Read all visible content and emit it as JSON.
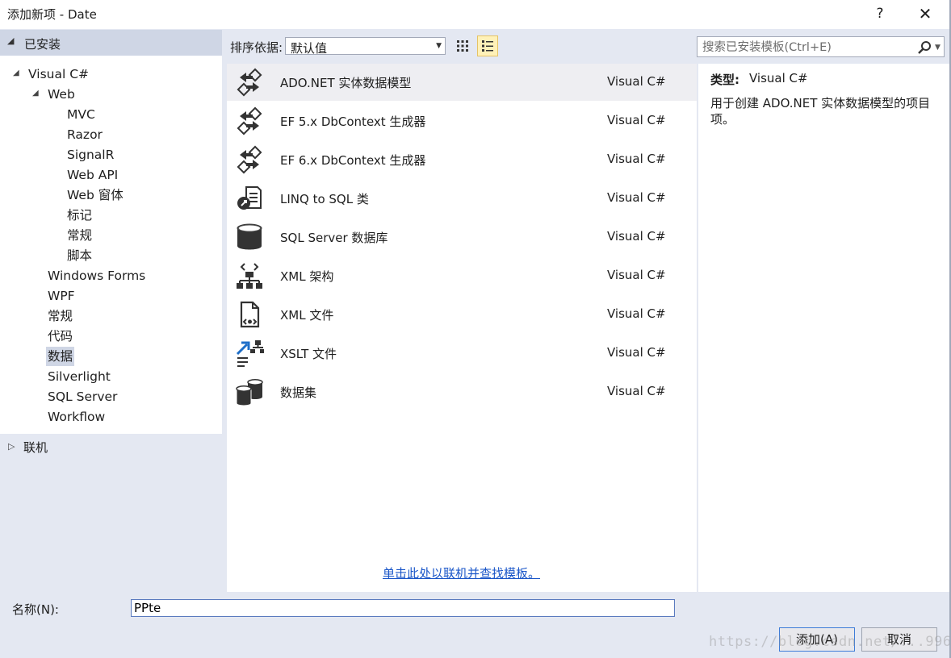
{
  "window": {
    "title": "添加新项 - Date",
    "help_glyph": "?",
    "close_glyph": "✕"
  },
  "sidebar": {
    "installed_label": "已安装",
    "tree": [
      {
        "label": "Visual C#",
        "expanded": true
      },
      {
        "label": "Web",
        "expanded": true
      },
      {
        "label": "MVC"
      },
      {
        "label": "Razor"
      },
      {
        "label": "SignalR"
      },
      {
        "label": "Web API"
      },
      {
        "label": "Web 窗体"
      },
      {
        "label": "标记"
      },
      {
        "label": "常规"
      },
      {
        "label": "脚本"
      },
      {
        "label": "Windows Forms"
      },
      {
        "label": "WPF"
      },
      {
        "label": "常规"
      },
      {
        "label": "代码"
      },
      {
        "label": "数据",
        "selected": true
      },
      {
        "label": "Silverlight"
      },
      {
        "label": "SQL Server"
      },
      {
        "label": "Workflow"
      }
    ],
    "online_label": "联机"
  },
  "toolbar": {
    "sort_label": "排序依据:",
    "sort_value": "默认值",
    "search_placeholder": "搜索已安装模板(Ctrl+E)"
  },
  "templates": [
    {
      "name": "ADO.NET 实体数据模型",
      "type": "Visual C#",
      "icon": "entity-model-icon",
      "selected": true
    },
    {
      "name": "EF 5.x DbContext 生成器",
      "type": "Visual C#",
      "icon": "dbcontext-generator-icon"
    },
    {
      "name": "EF 6.x DbContext 生成器",
      "type": "Visual C#",
      "icon": "dbcontext-generator-icon"
    },
    {
      "name": "LINQ to SQL 类",
      "type": "Visual C#",
      "icon": "linq-to-sql-icon"
    },
    {
      "name": "SQL Server 数据库",
      "type": "Visual C#",
      "icon": "database-icon"
    },
    {
      "name": "XML 架构",
      "type": "Visual C#",
      "icon": "xml-schema-icon"
    },
    {
      "name": "XML 文件",
      "type": "Visual C#",
      "icon": "xml-file-icon"
    },
    {
      "name": "XSLT 文件",
      "type": "Visual C#",
      "icon": "xslt-file-icon"
    },
    {
      "name": "数据集",
      "type": "Visual C#",
      "icon": "dataset-icon"
    }
  ],
  "online_link": "单击此处以联机并查找模板。",
  "info": {
    "type_label": "类型:",
    "type_value": "Visual C#",
    "description": "用于创建 ADO.NET 实体数据模型的项目项。"
  },
  "bottom": {
    "name_label": "名称(N):",
    "name_value": "PPte",
    "add_label": "添加(A)",
    "cancel_label": "取消"
  },
  "watermark": "https://blog.csdn.net/...996",
  "colors": {
    "accent": "#3d7cd8",
    "link": "#1a56c8",
    "panel_bg": "#e4e8f2",
    "selected_row": "#eeeef2"
  }
}
